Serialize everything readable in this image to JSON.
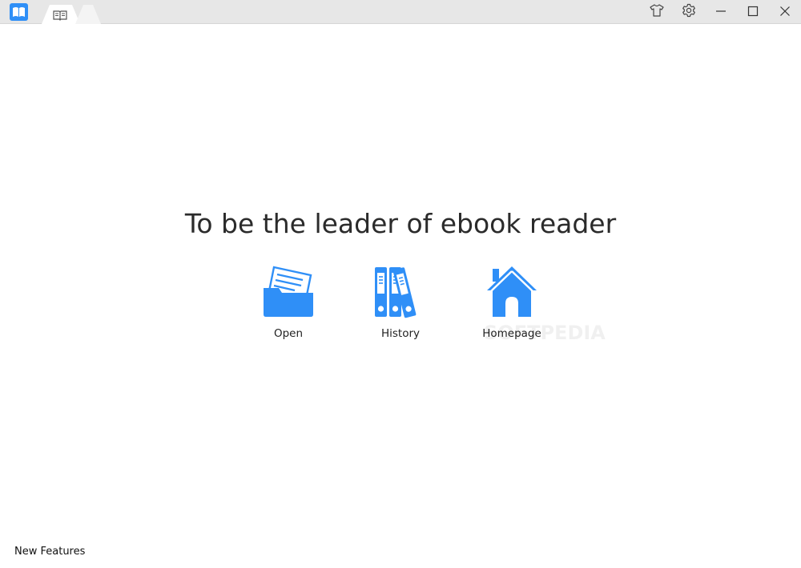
{
  "titlebar": {
    "icons": [
      "app-logo-icon",
      "book-icon",
      "tshirt-icon",
      "gear-icon",
      "minimize-icon",
      "maximize-icon",
      "close-icon"
    ]
  },
  "main": {
    "tagline": "To be the leader of ebook reader",
    "actions": [
      {
        "label": "Open",
        "icon": "folder-icon"
      },
      {
        "label": "History",
        "icon": "binders-icon"
      },
      {
        "label": "Homepage",
        "icon": "house-icon"
      }
    ],
    "watermark": "SOFTPEDIA"
  },
  "footer": {
    "new_features_label": "New Features"
  },
  "colors": {
    "accent": "#2f8ff7",
    "titlebar_bg": "#e7e7e7"
  }
}
